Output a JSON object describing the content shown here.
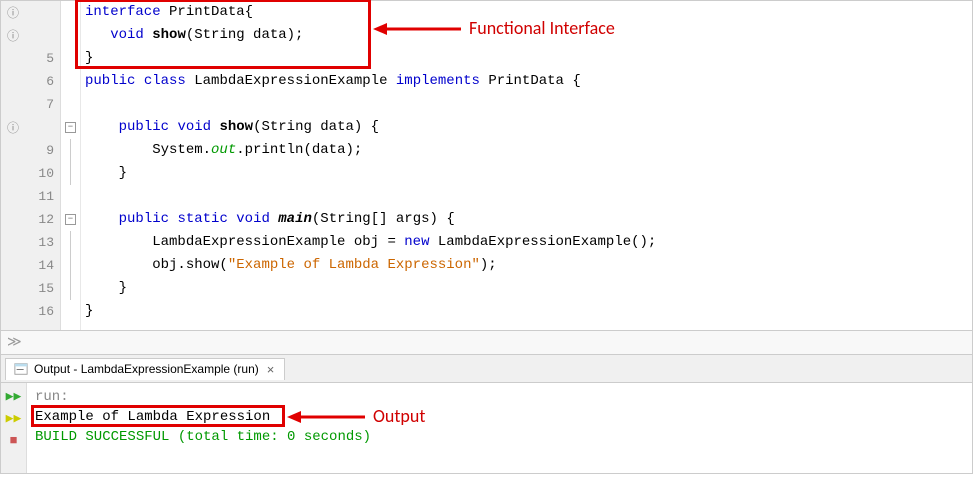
{
  "editor": {
    "gutter": [
      {
        "num": "",
        "icon": "ⓘ"
      },
      {
        "num": "",
        "icon": "ⓘ"
      },
      {
        "num": "5",
        "icon": ""
      },
      {
        "num": "6",
        "icon": ""
      },
      {
        "num": "7",
        "icon": ""
      },
      {
        "num": "",
        "icon": "ⓘ",
        "fold": "-"
      },
      {
        "num": "9",
        "icon": ""
      },
      {
        "num": "10",
        "icon": ""
      },
      {
        "num": "11",
        "icon": ""
      },
      {
        "num": "12",
        "icon": "",
        "fold": "-"
      },
      {
        "num": "13",
        "icon": ""
      },
      {
        "num": "14",
        "icon": ""
      },
      {
        "num": "15",
        "icon": ""
      },
      {
        "num": "16",
        "icon": ""
      }
    ],
    "lines": {
      "l1_kw": "interface",
      "l1_name": "PrintData{",
      "l2_kw": "void",
      "l2_meth": "show",
      "l2_rest": "(String data);",
      "l3": "}",
      "l4_kw1": "public",
      "l4_kw2": "class",
      "l4_name": "LambdaExpressionExample",
      "l4_kw3": "implements",
      "l4_iface": "PrintData {",
      "l5": "",
      "l6_kw1": "public",
      "l6_kw2": "void",
      "l6_meth": "show",
      "l6_rest": "(String data) {",
      "l7_a": "System.",
      "l7_out": "out",
      "l7_b": ".println(data);",
      "l8": "}",
      "l9": "",
      "l10_kw1": "public",
      "l10_kw2": "static",
      "l10_kw3": "void",
      "l10_main": "main",
      "l10_rest": "(String[] args) {",
      "l11_a": "LambdaExpressionExample obj = ",
      "l11_kw": "new",
      "l11_b": " LambdaExpressionExample();",
      "l12_a": "obj.show(",
      "l12_str": "\"Example of Lambda Expression\"",
      "l12_b": ");",
      "l13": "}",
      "l14": "}"
    },
    "annotations": {
      "functional_interface": "Functional Interface",
      "output_label": "Output"
    }
  },
  "output": {
    "tab_title": "Output - LambdaExpressionExample (run)",
    "lines": {
      "run": "run:",
      "result": "Example of Lambda Expression",
      "build": "BUILD SUCCESSFUL (total time: 0 seconds)"
    }
  }
}
